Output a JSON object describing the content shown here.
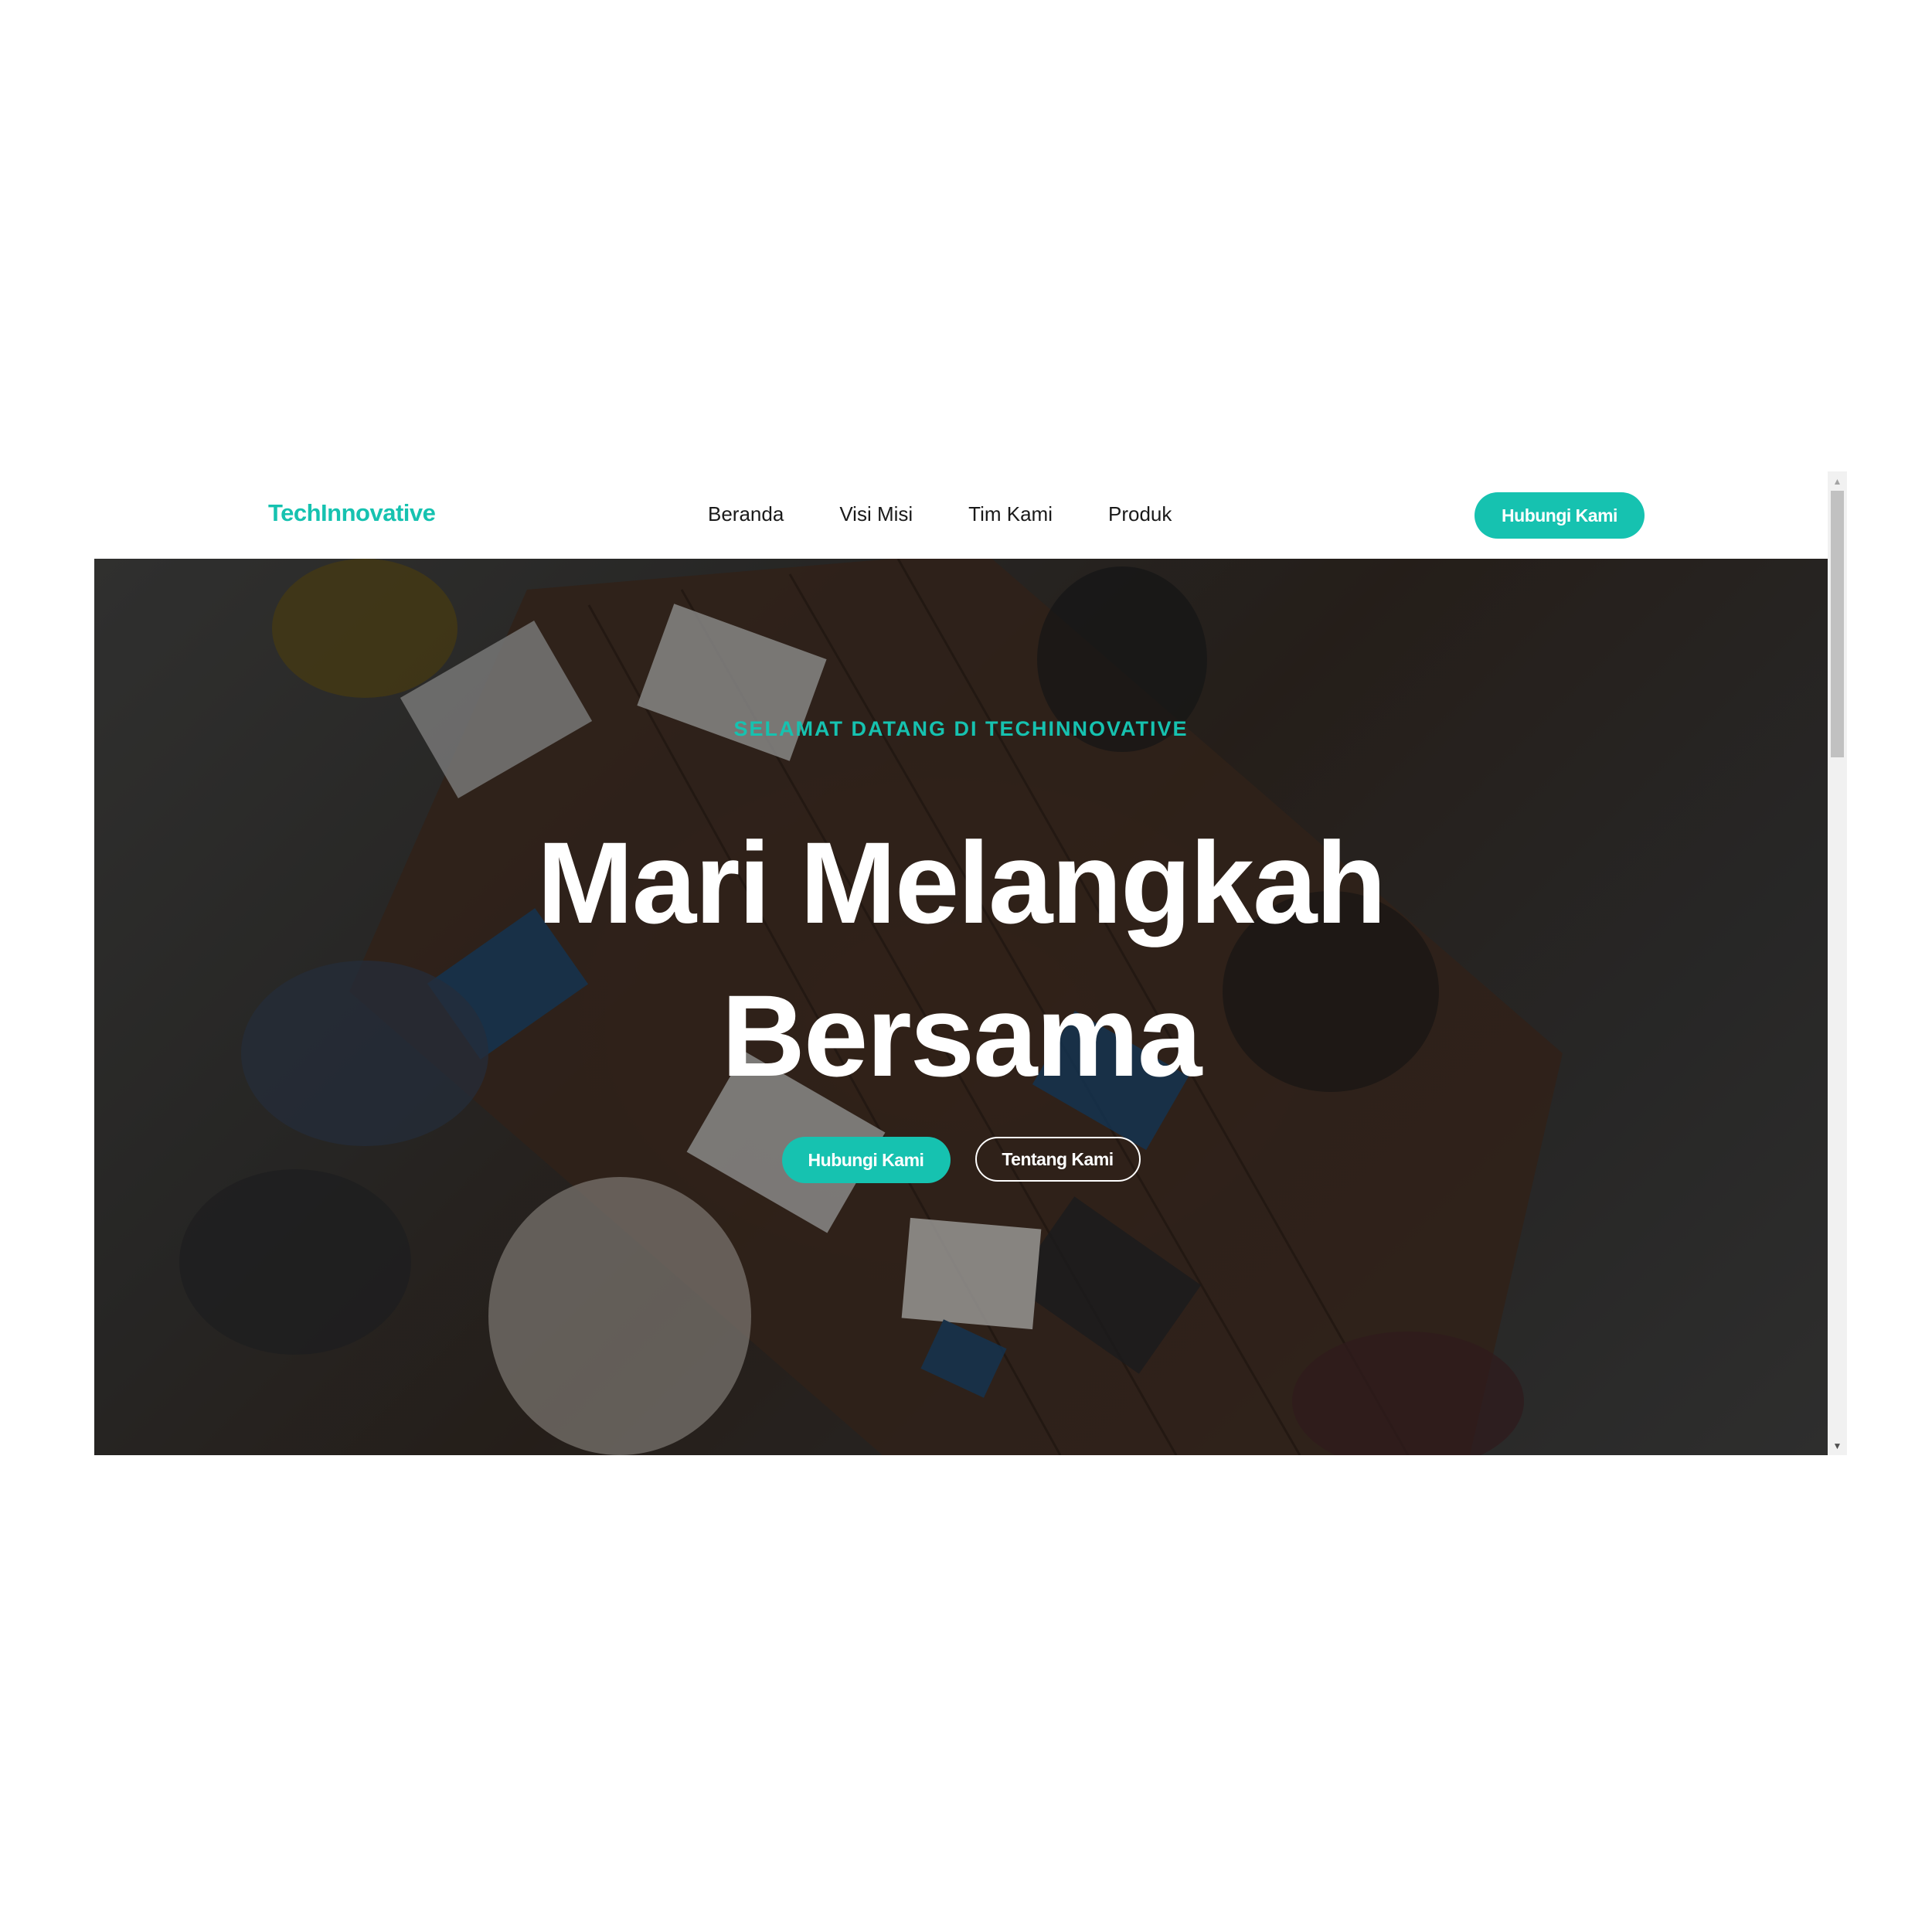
{
  "navbar": {
    "brand": "TechInnovative",
    "links": [
      "Beranda",
      "Visi Misi",
      "Tim Kami",
      "Produk"
    ],
    "cta_label": "Hubungi Kami"
  },
  "hero": {
    "eyebrow": "SELAMAT DATANG DI TECHINNOVATIVE",
    "headline_line1": "Mari Melangkah",
    "headline_line2": "Bersama",
    "primary_button": "Hubungi Kami",
    "secondary_button": "Tentang Kami"
  },
  "colors": {
    "accent": "#16c2b0",
    "text_dark": "#1a1a1a",
    "text_light": "#ffffff"
  },
  "icons": {
    "scroll_up": "chevron-up-icon",
    "scroll_down": "chevron-down-icon"
  }
}
